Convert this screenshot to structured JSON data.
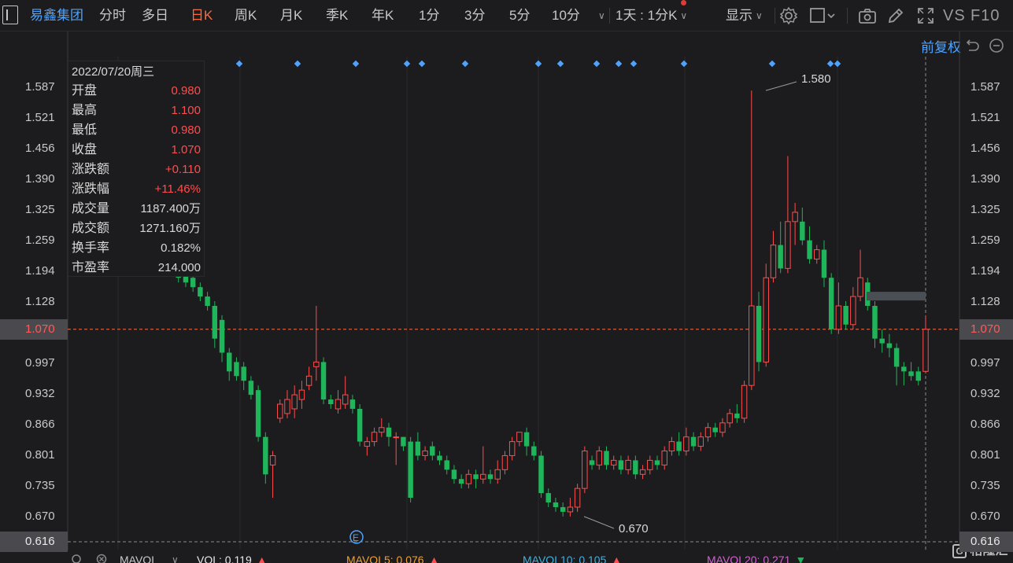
{
  "toolbar": {
    "stock_name": "易鑫集团",
    "periods": [
      "分时",
      "多日",
      "日K",
      "周K",
      "月K",
      "季K",
      "年K",
      "1分",
      "3分",
      "5分",
      "10分"
    ],
    "active_period": "日K",
    "multi_period": "1天 : 1分K",
    "display_label": "显示",
    "vs_label": "VS",
    "f10_label": "F10"
  },
  "adjust_label": "前复权",
  "price_axis": [
    "1.587",
    "1.521",
    "1.456",
    "1.390",
    "1.325",
    "1.259",
    "1.194",
    "1.128",
    "1.070",
    "0.997",
    "0.932",
    "0.866",
    "0.801",
    "0.735",
    "0.670",
    "0.616"
  ],
  "current_price_tag": "1.070",
  "low_price_tag": "0.616",
  "info_panel": {
    "date": "2022/07/20周三",
    "rows": [
      {
        "k": "开盘",
        "v": "0.980"
      },
      {
        "k": "最高",
        "v": "1.100"
      },
      {
        "k": "最低",
        "v": "0.980"
      },
      {
        "k": "收盘",
        "v": "1.070"
      },
      {
        "k": "涨跌额",
        "v": "+0.110"
      },
      {
        "k": "涨跌幅",
        "v": "+11.46%"
      },
      {
        "k": "成交量",
        "v": "1187.400万"
      },
      {
        "k": "成交额",
        "v": "1271.160万"
      },
      {
        "k": "换手率",
        "v": "0.182%"
      },
      {
        "k": "市盈率",
        "v": "214.000"
      }
    ]
  },
  "annotations": {
    "high": "1.580",
    "low": "0.670",
    "event_marker": "E"
  },
  "bottom_bar": {
    "mavol": "MAVOL",
    "vol": "VOL: 0.119",
    "mavol5": "MAVOL5: 0.076",
    "mavol10": "MAVOL10: 0.105",
    "mavol20": "MAVOL20: 0.271"
  },
  "watermark": "格隆汇",
  "colors": {
    "up": "#ff4d4d",
    "down": "#1fb55a",
    "accent": "#ff6a3d",
    "blue": "#4da3ff",
    "marker": "#4da3ff"
  },
  "chart_data": {
    "type": "candlestick",
    "ylim": [
      0.616,
      1.62
    ],
    "candles": [
      [
        1.32,
        1.33,
        1.3,
        1.36
      ],
      [
        1.33,
        1.36,
        1.32,
        1.4
      ],
      [
        1.36,
        1.35,
        1.33,
        1.38
      ],
      [
        1.35,
        1.37,
        1.34,
        1.39
      ],
      [
        1.37,
        1.36,
        1.33,
        1.41
      ],
      [
        1.25,
        1.22,
        1.2,
        1.28
      ],
      [
        1.22,
        1.24,
        1.2,
        1.31
      ],
      [
        1.24,
        1.21,
        1.19,
        1.25
      ],
      [
        1.23,
        1.18,
        1.17,
        1.24
      ],
      [
        1.19,
        1.17,
        1.16,
        1.2
      ],
      [
        1.18,
        1.16,
        1.15,
        1.19
      ],
      [
        1.16,
        1.14,
        1.13,
        1.17
      ],
      [
        1.14,
        1.12,
        1.11,
        1.15
      ],
      [
        1.12,
        1.05,
        1.03,
        1.13
      ],
      [
        1.09,
        1.02,
        1.0,
        1.1
      ],
      [
        1.02,
        0.98,
        0.96,
        1.03
      ],
      [
        1.0,
        0.97,
        0.96,
        1.01
      ],
      [
        0.99,
        0.96,
        0.94,
        1.0
      ],
      [
        0.96,
        0.93,
        0.92,
        0.97
      ],
      [
        0.94,
        0.84,
        0.83,
        0.95
      ],
      [
        0.84,
        0.76,
        0.74,
        0.85
      ],
      [
        0.78,
        0.8,
        0.71,
        0.81
      ],
      [
        0.88,
        0.91,
        0.87,
        0.92
      ],
      [
        0.89,
        0.92,
        0.88,
        0.94
      ],
      [
        0.9,
        0.93,
        0.88,
        0.95
      ],
      [
        0.92,
        0.94,
        0.9,
        0.96
      ],
      [
        0.95,
        0.97,
        0.94,
        0.99
      ],
      [
        0.99,
        1.0,
        0.96,
        1.12
      ],
      [
        1.0,
        0.92,
        0.91,
        1.01
      ],
      [
        0.92,
        0.91,
        0.9,
        0.93
      ],
      [
        0.9,
        0.92,
        0.89,
        0.94
      ],
      [
        0.91,
        0.93,
        0.9,
        0.97
      ],
      [
        0.92,
        0.9,
        0.89,
        0.93
      ],
      [
        0.9,
        0.83,
        0.82,
        0.91
      ],
      [
        0.82,
        0.83,
        0.8,
        0.84
      ],
      [
        0.83,
        0.85,
        0.82,
        0.86
      ],
      [
        0.85,
        0.86,
        0.84,
        0.88
      ],
      [
        0.86,
        0.84,
        0.82,
        0.87
      ],
      [
        0.84,
        0.84,
        0.78,
        0.85
      ],
      [
        0.84,
        0.82,
        0.81,
        0.84
      ],
      [
        0.83,
        0.71,
        0.7,
        0.84
      ],
      [
        0.83,
        0.8,
        0.79,
        0.85
      ],
      [
        0.8,
        0.81,
        0.79,
        0.82
      ],
      [
        0.82,
        0.8,
        0.79,
        0.83
      ],
      [
        0.8,
        0.79,
        0.78,
        0.81
      ],
      [
        0.79,
        0.77,
        0.76,
        0.8
      ],
      [
        0.77,
        0.75,
        0.74,
        0.78
      ],
      [
        0.75,
        0.74,
        0.73,
        0.76
      ],
      [
        0.74,
        0.76,
        0.73,
        0.77
      ],
      [
        0.76,
        0.75,
        0.73,
        0.77
      ],
      [
        0.75,
        0.76,
        0.74,
        0.82
      ],
      [
        0.76,
        0.75,
        0.74,
        0.77
      ],
      [
        0.75,
        0.77,
        0.74,
        0.79
      ],
      [
        0.77,
        0.8,
        0.76,
        0.81
      ],
      [
        0.8,
        0.83,
        0.79,
        0.84
      ],
      [
        0.83,
        0.85,
        0.82,
        0.85
      ],
      [
        0.85,
        0.82,
        0.8,
        0.86
      ],
      [
        0.82,
        0.8,
        0.79,
        0.83
      ],
      [
        0.8,
        0.72,
        0.71,
        0.81
      ],
      [
        0.72,
        0.7,
        0.69,
        0.73
      ],
      [
        0.7,
        0.69,
        0.68,
        0.71
      ],
      [
        0.69,
        0.68,
        0.67,
        0.7
      ],
      [
        0.68,
        0.69,
        0.67,
        0.71
      ],
      [
        0.69,
        0.73,
        0.68,
        0.74
      ],
      [
        0.73,
        0.81,
        0.72,
        0.82
      ],
      [
        0.79,
        0.78,
        0.77,
        0.8
      ],
      [
        0.78,
        0.81,
        0.77,
        0.82
      ],
      [
        0.81,
        0.78,
        0.77,
        0.82
      ],
      [
        0.78,
        0.79,
        0.77,
        0.8
      ],
      [
        0.79,
        0.77,
        0.76,
        0.8
      ],
      [
        0.77,
        0.79,
        0.76,
        0.8
      ],
      [
        0.79,
        0.76,
        0.75,
        0.8
      ],
      [
        0.76,
        0.77,
        0.75,
        0.78
      ],
      [
        0.77,
        0.79,
        0.76,
        0.8
      ],
      [
        0.79,
        0.78,
        0.77,
        0.8
      ],
      [
        0.78,
        0.81,
        0.77,
        0.82
      ],
      [
        0.81,
        0.83,
        0.8,
        0.84
      ],
      [
        0.83,
        0.81,
        0.8,
        0.85
      ],
      [
        0.81,
        0.84,
        0.8,
        0.86
      ],
      [
        0.84,
        0.82,
        0.81,
        0.85
      ],
      [
        0.82,
        0.84,
        0.81,
        0.85
      ],
      [
        0.84,
        0.86,
        0.83,
        0.87
      ],
      [
        0.86,
        0.85,
        0.84,
        0.87
      ],
      [
        0.85,
        0.87,
        0.84,
        0.88
      ],
      [
        0.87,
        0.89,
        0.86,
        0.9
      ],
      [
        0.89,
        0.88,
        0.87,
        0.91
      ],
      [
        0.88,
        0.95,
        0.87,
        0.96
      ],
      [
        0.95,
        1.12,
        0.94,
        1.58
      ],
      [
        1.12,
        1.0,
        0.98,
        1.15
      ],
      [
        1.0,
        1.18,
        0.99,
        1.21
      ],
      [
        1.18,
        1.25,
        1.17,
        1.28
      ],
      [
        1.25,
        1.2,
        1.19,
        1.3
      ],
      [
        1.2,
        1.3,
        1.19,
        1.44
      ],
      [
        1.3,
        1.32,
        1.25,
        1.34
      ],
      [
        1.3,
        1.26,
        1.25,
        1.33
      ],
      [
        1.26,
        1.22,
        1.21,
        1.29
      ],
      [
        1.22,
        1.24,
        1.21,
        1.25
      ],
      [
        1.24,
        1.18,
        1.16,
        1.26
      ],
      [
        1.18,
        1.07,
        1.06,
        1.19
      ],
      [
        1.07,
        1.12,
        1.06,
        1.17
      ],
      [
        1.12,
        1.08,
        1.07,
        1.13
      ],
      [
        1.08,
        1.14,
        1.07,
        1.16
      ],
      [
        1.14,
        1.18,
        1.13,
        1.24
      ],
      [
        1.17,
        1.12,
        1.11,
        1.18
      ],
      [
        1.12,
        1.05,
        1.03,
        1.13
      ],
      [
        1.05,
        1.04,
        1.02,
        1.07
      ],
      [
        1.04,
        1.03,
        1.01,
        1.06
      ],
      [
        1.03,
        0.99,
        0.95,
        1.04
      ],
      [
        0.99,
        0.98,
        0.95,
        1.0
      ],
      [
        0.98,
        0.97,
        0.96,
        1.0
      ],
      [
        0.98,
        0.96,
        0.95,
        0.99
      ],
      [
        0.98,
        1.07,
        0.98,
        1.1
      ]
    ]
  }
}
